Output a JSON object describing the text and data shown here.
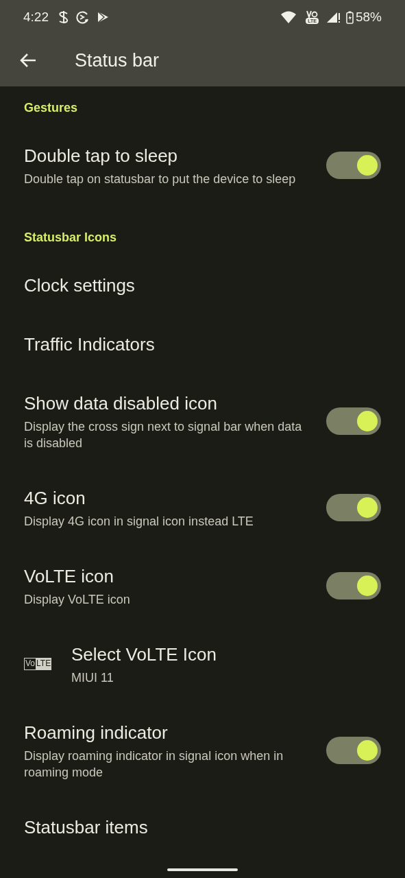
{
  "status_bar": {
    "time": "4:22",
    "network_badge": "LTE",
    "battery": "58%"
  },
  "app_bar": {
    "title": "Status bar"
  },
  "items": [
    {
      "kind": "header",
      "title": "Gestures"
    },
    {
      "kind": "switch",
      "title": "Double tap to sleep",
      "summary": "Double tap on statusbar to put the device to sleep",
      "on": true
    },
    {
      "kind": "header",
      "title": "Statusbar Icons"
    },
    {
      "kind": "link",
      "title": "Clock settings"
    },
    {
      "kind": "link",
      "title": "Traffic Indicators"
    },
    {
      "kind": "switch",
      "title": "Show data disabled icon",
      "summary": "Display the cross sign next to signal bar when data is disabled",
      "on": true
    },
    {
      "kind": "switch",
      "title": "4G icon",
      "summary": "Display 4G icon in signal icon instead LTE",
      "on": true
    },
    {
      "kind": "switch",
      "title": "VoLTE icon",
      "summary": "Display VoLTE icon",
      "on": true
    },
    {
      "kind": "icon_link",
      "title": "Select VoLTE Icon",
      "summary": "MIUI 11",
      "icon_text": [
        "Vo",
        "LTE"
      ]
    },
    {
      "kind": "switch",
      "title": "Roaming indicator",
      "summary": "Display roaming indicator in signal icon when in roaming mode",
      "on": true
    },
    {
      "kind": "link",
      "title": "Statusbar items"
    }
  ]
}
